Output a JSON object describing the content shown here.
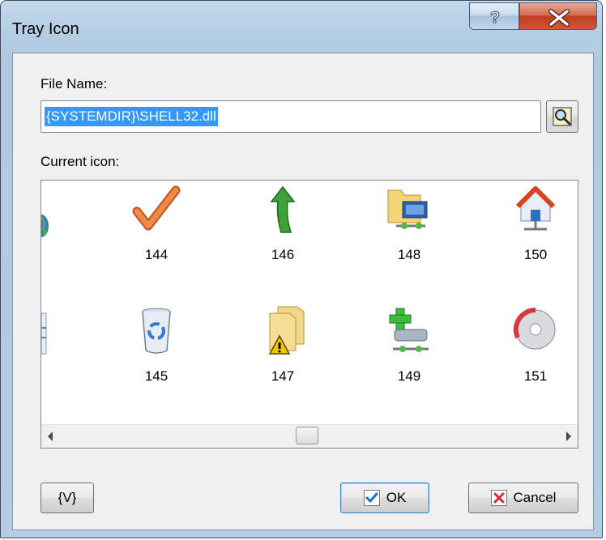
{
  "window": {
    "title": "Tray Icon",
    "help_symbol": "?",
    "close_symbol": "x"
  },
  "file_name": {
    "label": "File Name:",
    "value": "{SYSTEMDIR}\\SHELL32.dll"
  },
  "current_icon": {
    "label": "Current icon:",
    "icons": [
      {
        "number": "144",
        "icon": "check-mark-icon"
      },
      {
        "number": "145",
        "icon": "recycle-bin-icon"
      },
      {
        "number": "146",
        "icon": "up-arrow-icon"
      },
      {
        "number": "147",
        "icon": "folder-warning-icon"
      },
      {
        "number": "148",
        "icon": "network-folder-icon"
      },
      {
        "number": "149",
        "icon": "add-network-drive-icon"
      },
      {
        "number": "150",
        "icon": "network-home-icon"
      },
      {
        "number": "151",
        "icon": "cd-disc-icon"
      }
    ]
  },
  "buttons": {
    "variables": "{V}",
    "ok": "OK",
    "cancel": "Cancel"
  },
  "colors": {
    "selection": "#3399ff",
    "close_button": "#c0401f",
    "window_frame": "#b3cde3"
  }
}
